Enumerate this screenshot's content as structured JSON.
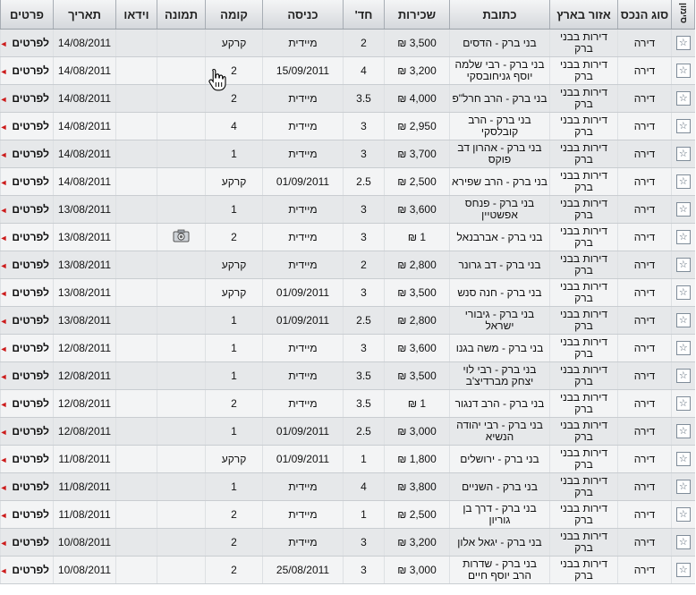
{
  "headers": {
    "mark": "סימון",
    "type": "סוג הנכס",
    "area": "אזור בארץ",
    "address": "כתובת",
    "rent": "שכירות",
    "rooms": "חד'",
    "entry": "כניסה",
    "floor": "קומה",
    "picture": "תמונה",
    "video": "וידאו",
    "date": "תאריך",
    "details": "פרטים"
  },
  "icons": {
    "mark": "star-icon",
    "photo": "camera-icon",
    "details_arrow": "arrow-left-icon",
    "cursor": "hand-cursor-icon"
  },
  "colors": {
    "arrow": "#cc1b1b",
    "header_bg": "#dfe2e5"
  },
  "rows": [
    {
      "type": "דירה",
      "area": "דירות בבני ברק",
      "address": "בני ברק - הדסים",
      "rent": "3,500 ₪",
      "rooms": "2",
      "entry": "מיידית",
      "floor": "קרקע",
      "picture": false,
      "video": "",
      "date": "14/08/2011",
      "details": "לפרטים"
    },
    {
      "type": "דירה",
      "area": "דירות בבני ברק",
      "address": "בני ברק - רבי שלמה יוסף גניחובסקי",
      "rent": "3,200 ₪",
      "rooms": "4",
      "entry": "15/09/2011",
      "floor": "2",
      "picture": false,
      "video": "",
      "date": "14/08/2011",
      "details": "לפרטים"
    },
    {
      "type": "דירה",
      "area": "דירות בבני ברק",
      "address": "בני ברק - הרב חרל\"פ",
      "rent": "4,000 ₪",
      "rooms": "3.5",
      "entry": "מיידית",
      "floor": "2",
      "picture": false,
      "video": "",
      "date": "14/08/2011",
      "details": "לפרטים"
    },
    {
      "type": "דירה",
      "area": "דירות בבני ברק",
      "address": "בני ברק - הרב קובלסקי",
      "rent": "2,950 ₪",
      "rooms": "3",
      "entry": "מיידית",
      "floor": "4",
      "picture": false,
      "video": "",
      "date": "14/08/2011",
      "details": "לפרטים"
    },
    {
      "type": "דירה",
      "area": "דירות בבני ברק",
      "address": "בני ברק - אהרון דב פוקס",
      "rent": "3,700 ₪",
      "rooms": "3",
      "entry": "מיידית",
      "floor": "1",
      "picture": false,
      "video": "",
      "date": "14/08/2011",
      "details": "לפרטים"
    },
    {
      "type": "דירה",
      "area": "דירות בבני ברק",
      "address": "בני ברק - הרב שפירא",
      "rent": "2,500 ₪",
      "rooms": "2.5",
      "entry": "01/09/2011",
      "floor": "קרקע",
      "picture": false,
      "video": "",
      "date": "14/08/2011",
      "details": "לפרטים"
    },
    {
      "type": "דירה",
      "area": "דירות בבני ברק",
      "address": "בני ברק - פנחס אפשטיין",
      "rent": "3,600 ₪",
      "rooms": "3",
      "entry": "מיידית",
      "floor": "1",
      "picture": false,
      "video": "",
      "date": "13/08/2011",
      "details": "לפרטים"
    },
    {
      "type": "דירה",
      "area": "דירות בבני ברק",
      "address": "בני ברק - אברבנאל",
      "rent": "1 ₪",
      "rooms": "3",
      "entry": "מיידית",
      "floor": "2",
      "picture": true,
      "video": "",
      "date": "13/08/2011",
      "details": "לפרטים"
    },
    {
      "type": "דירה",
      "area": "דירות בבני ברק",
      "address": "בני ברק - דב גרונר",
      "rent": "2,800 ₪",
      "rooms": "2",
      "entry": "מיידית",
      "floor": "קרקע",
      "picture": false,
      "video": "",
      "date": "13/08/2011",
      "details": "לפרטים"
    },
    {
      "type": "דירה",
      "area": "דירות בבני ברק",
      "address": "בני ברק - חנה סנש",
      "rent": "3,500 ₪",
      "rooms": "3",
      "entry": "01/09/2011",
      "floor": "קרקע",
      "picture": false,
      "video": "",
      "date": "13/08/2011",
      "details": "לפרטים"
    },
    {
      "type": "דירה",
      "area": "דירות בבני ברק",
      "address": "בני ברק - גיבורי ישראל",
      "rent": "2,800 ₪",
      "rooms": "2.5",
      "entry": "01/09/2011",
      "floor": "1",
      "picture": false,
      "video": "",
      "date": "13/08/2011",
      "details": "לפרטים"
    },
    {
      "type": "דירה",
      "area": "דירות בבני ברק",
      "address": "בני ברק - משה בגנו",
      "rent": "3,600 ₪",
      "rooms": "3",
      "entry": "מיידית",
      "floor": "1",
      "picture": false,
      "video": "",
      "date": "12/08/2011",
      "details": "לפרטים"
    },
    {
      "type": "דירה",
      "area": "דירות בבני ברק",
      "address": "בני ברק - רבי לוי יצחק מברדיצ'ב",
      "rent": "3,500 ₪",
      "rooms": "3.5",
      "entry": "מיידית",
      "floor": "1",
      "picture": false,
      "video": "",
      "date": "12/08/2011",
      "details": "לפרטים"
    },
    {
      "type": "דירה",
      "area": "דירות בבני ברק",
      "address": "בני ברק - הרב דנגור",
      "rent": "1 ₪",
      "rooms": "3.5",
      "entry": "מיידית",
      "floor": "2",
      "picture": false,
      "video": "",
      "date": "12/08/2011",
      "details": "לפרטים"
    },
    {
      "type": "דירה",
      "area": "דירות בבני ברק",
      "address": "בני ברק - רבי יהודה הנשיא",
      "rent": "3,000 ₪",
      "rooms": "2.5",
      "entry": "01/09/2011",
      "floor": "1",
      "picture": false,
      "video": "",
      "date": "12/08/2011",
      "details": "לפרטים"
    },
    {
      "type": "דירה",
      "area": "דירות בבני ברק",
      "address": "בני ברק - ירושלים",
      "rent": "1,800 ₪",
      "rooms": "1",
      "entry": "01/09/2011",
      "floor": "קרקע",
      "picture": false,
      "video": "",
      "date": "11/08/2011",
      "details": "לפרטים"
    },
    {
      "type": "דירה",
      "area": "דירות בבני ברק",
      "address": "בני ברק - השניים",
      "rent": "3,800 ₪",
      "rooms": "4",
      "entry": "מיידית",
      "floor": "1",
      "picture": false,
      "video": "",
      "date": "11/08/2011",
      "details": "לפרטים"
    },
    {
      "type": "דירה",
      "area": "דירות בבני ברק",
      "address": "בני ברק - דרך בן גוריון",
      "rent": "2,500 ₪",
      "rooms": "1",
      "entry": "מיידית",
      "floor": "2",
      "picture": false,
      "video": "",
      "date": "11/08/2011",
      "details": "לפרטים"
    },
    {
      "type": "דירה",
      "area": "דירות בבני ברק",
      "address": "בני ברק - יגאל אלון",
      "rent": "3,200 ₪",
      "rooms": "3",
      "entry": "מיידית",
      "floor": "2",
      "picture": false,
      "video": "",
      "date": "10/08/2011",
      "details": "לפרטים"
    },
    {
      "type": "דירה",
      "area": "דירות בבני ברק",
      "address": "בני ברק - שדרות הרב יוסף חיים",
      "rent": "3,000 ₪",
      "rooms": "3",
      "entry": "25/08/2011",
      "floor": "2",
      "picture": false,
      "video": "",
      "date": "10/08/2011",
      "details": "לפרטים"
    }
  ]
}
